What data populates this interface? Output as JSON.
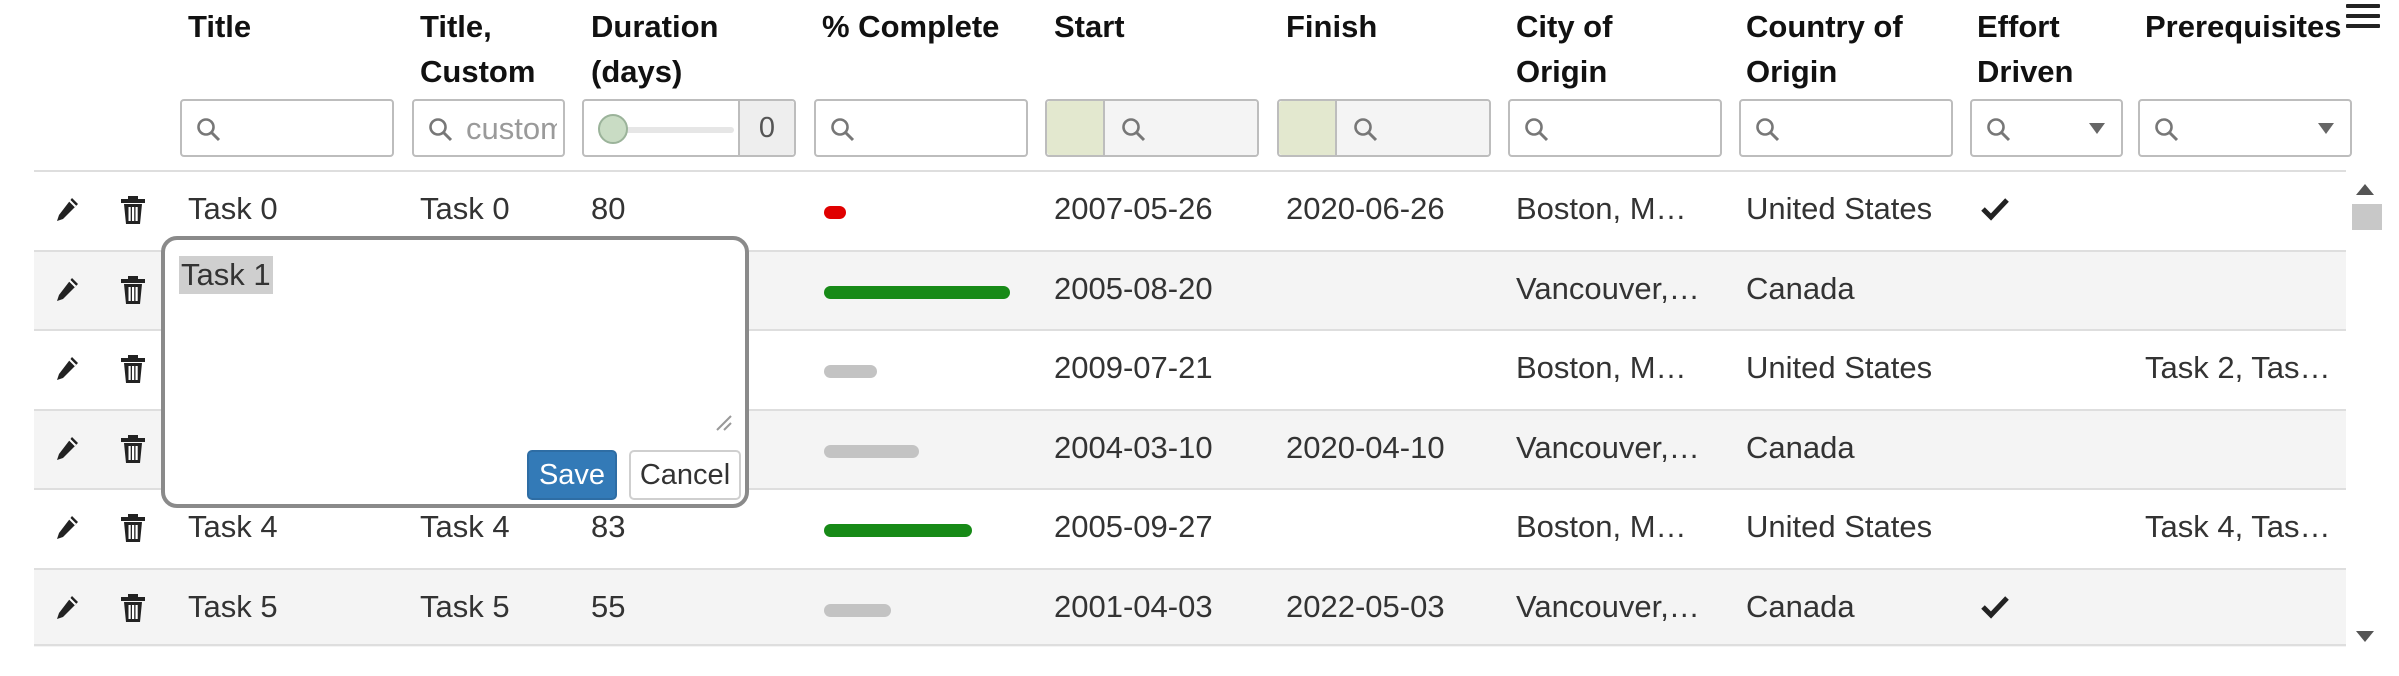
{
  "colors": {
    "accent": "#337ab7",
    "progress_red": "#e00000",
    "progress_green": "#178a17",
    "progress_gray": "#c3c3c3",
    "row_alt": "#f4f4f4"
  },
  "header": {
    "title_col": "Title",
    "title_custom_col_line1": "Title,",
    "title_custom_col_line2": "Custom",
    "duration_col_line1": "Duration",
    "duration_col_line2": "(days)",
    "complete_col": "% Complete",
    "start_col": "Start",
    "finish_col": "Finish",
    "city_col_line1": "City of",
    "city_col_line2": "Origin",
    "country_col_line1": "Country of",
    "country_col_line2": "Origin",
    "effort_col_line1": "Effort",
    "effort_col_line2": "Driven",
    "prereq_col": "Prerequisites",
    "menu_icon": "hamburger-menu-icon"
  },
  "filters": {
    "title_custom_placeholder": "custom",
    "duration_value": "0",
    "search_icon": "search-icon"
  },
  "rows": [
    {
      "title": "Task 0",
      "title_custom": "Task 0",
      "duration": "80",
      "complete": 2,
      "start": "2007-05-26",
      "finish": "2020-06-26",
      "city": "Boston, M…",
      "country": "United States",
      "effort_driven": true,
      "prerequisites": ""
    },
    {
      "title": "Task 1",
      "title_custom": "",
      "duration": "",
      "complete": 98,
      "start": "2005-08-20",
      "finish": "",
      "city": "Vancouver,…",
      "country": "Canada",
      "effort_driven": false,
      "prerequisites": ""
    },
    {
      "title": "",
      "title_custom": "",
      "duration": "",
      "complete": 28,
      "start": "2009-07-21",
      "finish": "",
      "city": "Boston, M…",
      "country": "United States",
      "effort_driven": false,
      "prerequisites": "Task 2, Tas…"
    },
    {
      "title": "",
      "title_custom": "",
      "duration": "",
      "complete": 50,
      "start": "2004-03-10",
      "finish": "2020-04-10",
      "city": "Vancouver,…",
      "country": "Canada",
      "effort_driven": false,
      "prerequisites": ""
    },
    {
      "title": "Task 4",
      "title_custom": "Task 4",
      "duration": "83",
      "complete": 78,
      "start": "2005-09-27",
      "finish": "",
      "city": "Boston, M…",
      "country": "United States",
      "effort_driven": false,
      "prerequisites": "Task 4, Tas…"
    },
    {
      "title": "Task 5",
      "title_custom": "Task 5",
      "duration": "55",
      "complete": 35,
      "start": "2001-04-03",
      "finish": "2022-05-03",
      "city": "Vancouver,…",
      "country": "Canada",
      "effort_driven": true,
      "prerequisites": ""
    }
  ],
  "editor": {
    "value": "Task 1",
    "save_label": "Save",
    "cancel_label": "Cancel"
  }
}
